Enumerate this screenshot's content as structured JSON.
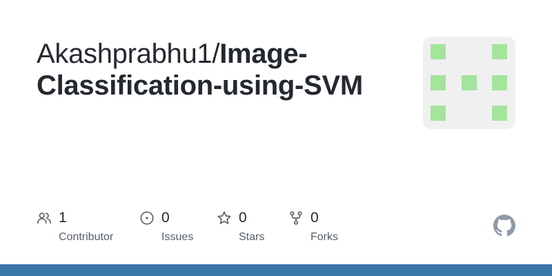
{
  "repo": {
    "owner_prefix": "Akashprabhu1/",
    "name_part1": "Image-",
    "name_part2": "Classification-using-SVM"
  },
  "avatar": {
    "icon": "identicon",
    "background_color": "#f0f0f0",
    "cell_color": "#a5e49d"
  },
  "stats": {
    "contributors": {
      "count": "1",
      "label": "Contributor",
      "icon": "people-icon"
    },
    "issues": {
      "count": "0",
      "label": "Issues",
      "icon": "issue-opened-icon"
    },
    "stars": {
      "count": "0",
      "label": "Stars",
      "icon": "star-icon"
    },
    "forks": {
      "count": "0",
      "label": "Forks",
      "icon": "repo-forked-icon"
    }
  },
  "brand": {
    "logo": "github-mark-icon",
    "footer_color": "#3a76a8"
  }
}
